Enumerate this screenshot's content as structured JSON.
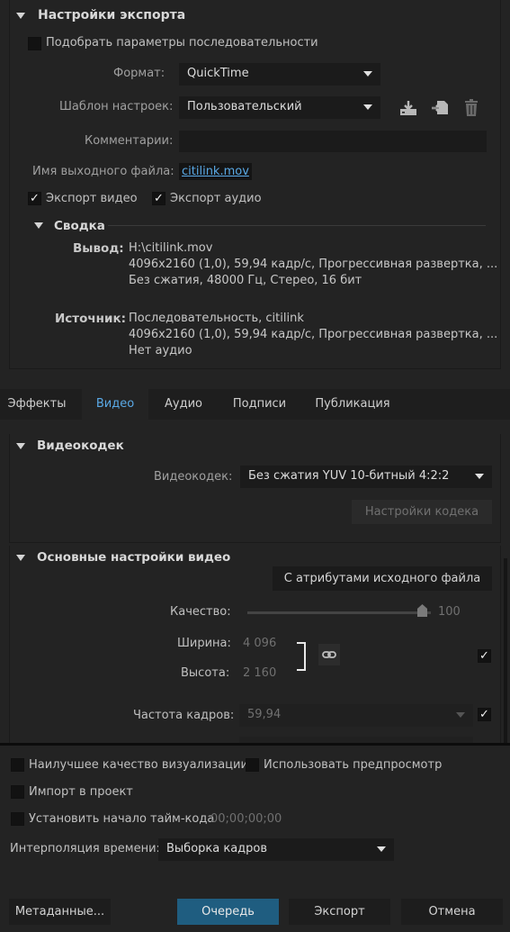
{
  "export_settings": {
    "title": "Настройки экспорта",
    "match_sequence_label": "Подобрать параметры последовательности",
    "format_label": "Формат:",
    "format_value": "QuickTime",
    "preset_label": "Шаблон настроек:",
    "preset_value": "Пользовательский",
    "comments_label": "Комментарии:",
    "comments_value": "",
    "output_name_label": "Имя выходного файла:",
    "output_name_value": "citilink.mov",
    "export_video_label": "Экспорт видео",
    "export_audio_label": "Экспорт аудио",
    "export_video_checked": true,
    "export_audio_checked": true
  },
  "summary": {
    "title": "Сводка",
    "output_label": "Вывод:",
    "output_lines": [
      "H:\\citilink.mov",
      "4096x2160 (1,0), 59,94 кадр/с, Прогрессивная развертка, ...",
      "Без сжатия, 48000 Гц, Стерео, 16 бит"
    ],
    "source_label": "Источник:",
    "source_lines": [
      "Последовательность, citilink",
      "4096x2160 (1,0), 59,94 кадр/с, Прогрессивная развертка, ...",
      "Нет аудио"
    ]
  },
  "tabs": [
    {
      "label": "Эффекты",
      "active": false
    },
    {
      "label": "Видео",
      "active": true
    },
    {
      "label": "Аудио",
      "active": false
    },
    {
      "label": "Подписи",
      "active": false
    },
    {
      "label": "Публикация",
      "active": false
    }
  ],
  "video_codec": {
    "title": "Видеокодек",
    "codec_label": "Видеокодек:",
    "codec_value": "Без сжатия YUV 10-битный 4:2:2",
    "codec_settings_button": "Настройки кодека"
  },
  "basic_video": {
    "title": "Основные настройки видео",
    "match_source_button": "С атрибутами исходного файла",
    "quality_label": "Качество:",
    "quality_value": "100",
    "quality_fraction": 1.0,
    "width_label": "Ширина:",
    "width_value": "4 096",
    "height_label": "Высота:",
    "height_value": "2 160",
    "frame_rate_label": "Частота кадров:",
    "frame_rate_value": "59,94"
  },
  "bottom": {
    "max_render_quality_label": "Наилучшее качество визуализации",
    "use_previews_label": "Использовать предпросмотр",
    "import_into_project_label": "Импорт в проект",
    "set_start_timecode_label": "Установить начало тайм-кода",
    "start_timecode_value": "00;00;00;00",
    "time_interpolation_label": "Интерполяция времени:",
    "time_interpolation_value": "Выборка кадров",
    "metadata_button": "Метаданные...",
    "queue_button": "Очередь",
    "export_button": "Экспорт",
    "cancel_button": "Отмена"
  },
  "colors": {
    "accent": "#1f5d80",
    "link": "#5aa9e6",
    "panel_bg": "#232323",
    "field_bg": "#1b1b1b"
  }
}
